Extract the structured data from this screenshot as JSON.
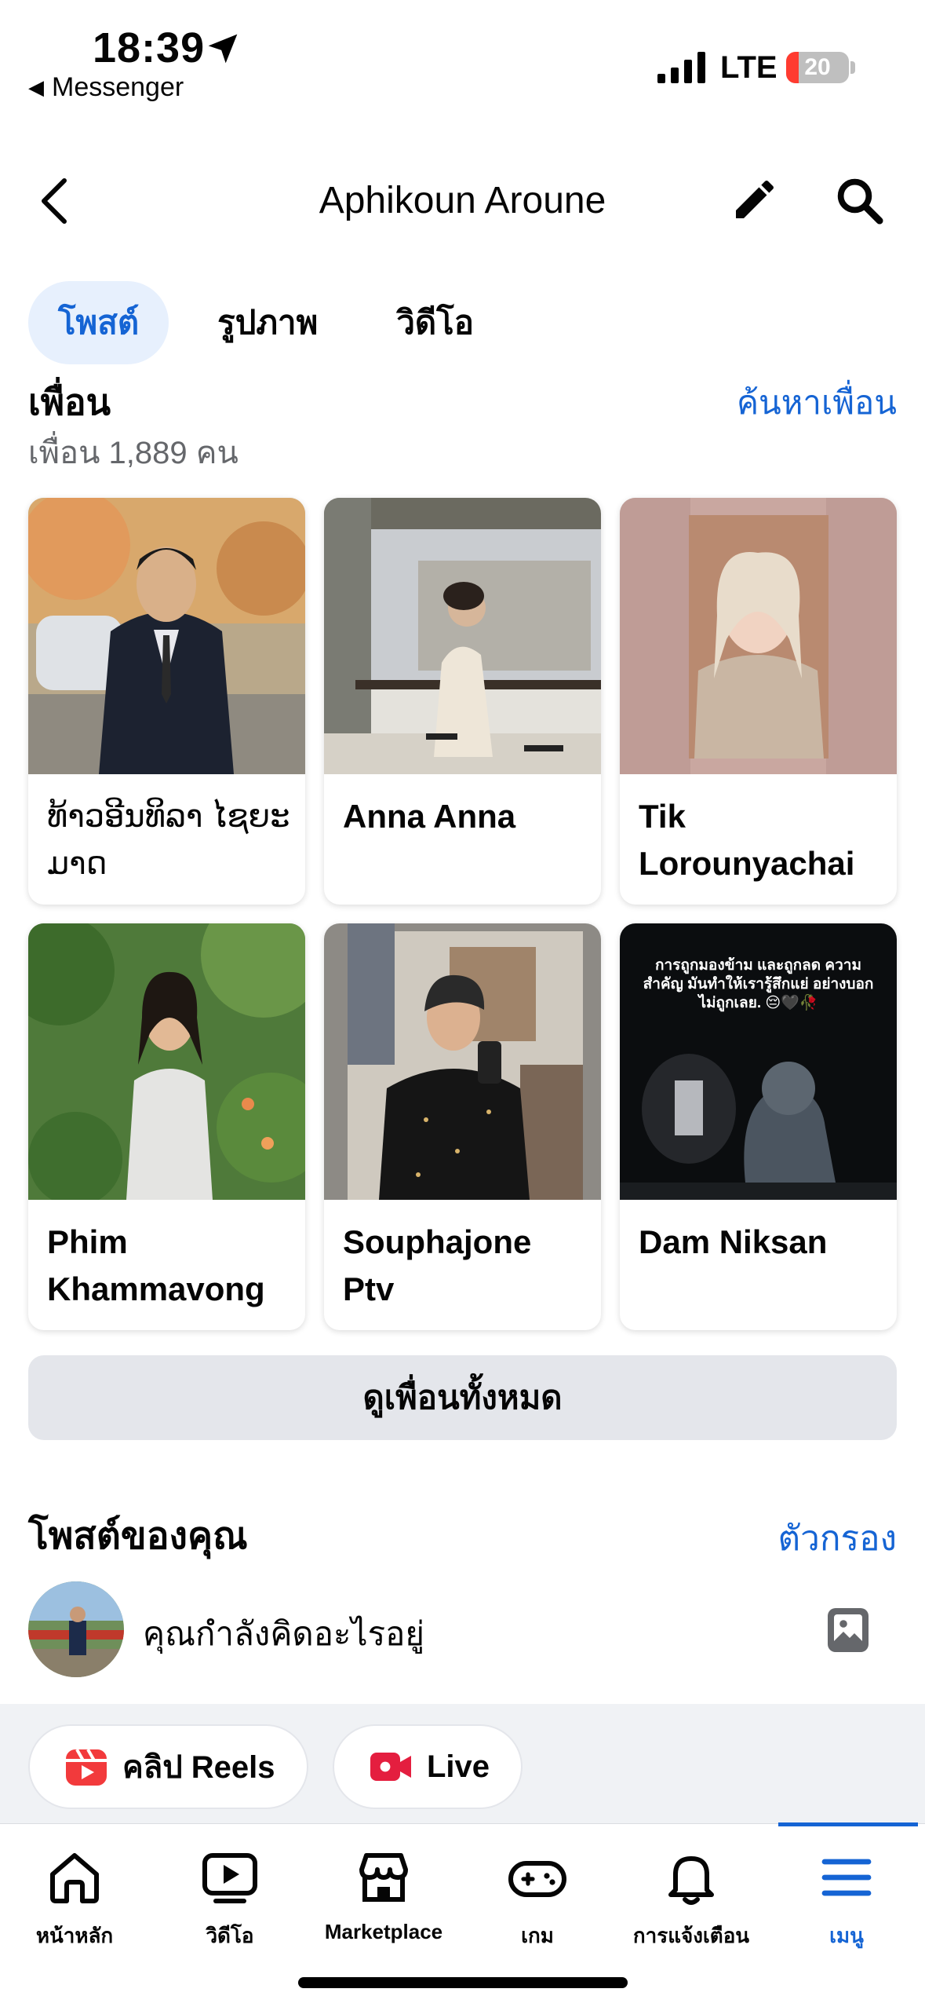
{
  "status_bar": {
    "time": "18:39",
    "back_app": "Messenger",
    "network": "LTE",
    "battery": "20",
    "battery_level": 0.2
  },
  "header": {
    "title": "Aphikoun Aroune"
  },
  "tabs": [
    {
      "label": "โพสต์",
      "active": true
    },
    {
      "label": "รูปภาพ",
      "active": false
    },
    {
      "label": "วิดีโอ",
      "active": false
    }
  ],
  "friends": {
    "title": "เพื่อน",
    "count": "เพื่อน 1,889 คน",
    "find_link": "ค้นหาเพื่อน",
    "list": [
      {
        "name": "ທ້າວອີນທິລາ ໄຊຍະມາດ"
      },
      {
        "name": "Anna Anna"
      },
      {
        "name": "Tik Lorounyachai"
      },
      {
        "name": "Phim Khammavong"
      },
      {
        "name": "Souphajone Ptv"
      },
      {
        "name": "Dam Niksan"
      }
    ],
    "photo_caption": "การถูกมองข้าม และถูกลด ความสำคัญ มันทำให้เรารู้สึกแย่ อย่างบอกไม่ถูกเลย. 😔🖤🥀",
    "see_all": "ดูเพื่อนทั้งหมด"
  },
  "posts": {
    "title": "โพสต์ของคุณ",
    "filter": "ตัวกรอง",
    "composer_placeholder": "คุณกำลังคิดอะไรอยู่",
    "reels_label": "คลิป Reels",
    "live_label": "Live"
  },
  "nav": [
    {
      "label": "หน้าหลัก",
      "icon": "home-icon"
    },
    {
      "label": "วิดีโอ",
      "icon": "video-icon"
    },
    {
      "label": "Marketplace",
      "icon": "marketplace-icon"
    },
    {
      "label": "เกม",
      "icon": "gaming-icon"
    },
    {
      "label": "การแจ้งเตือน",
      "icon": "bell-icon"
    },
    {
      "label": "เมนู",
      "icon": "menu-icon",
      "active": true
    }
  ],
  "colors": {
    "accent": "#1564d4",
    "tab_active_bg": "#e7f0fd",
    "button_bg": "#e4e6eb",
    "reels": "#f23a3c",
    "live": "#e41e3f"
  }
}
